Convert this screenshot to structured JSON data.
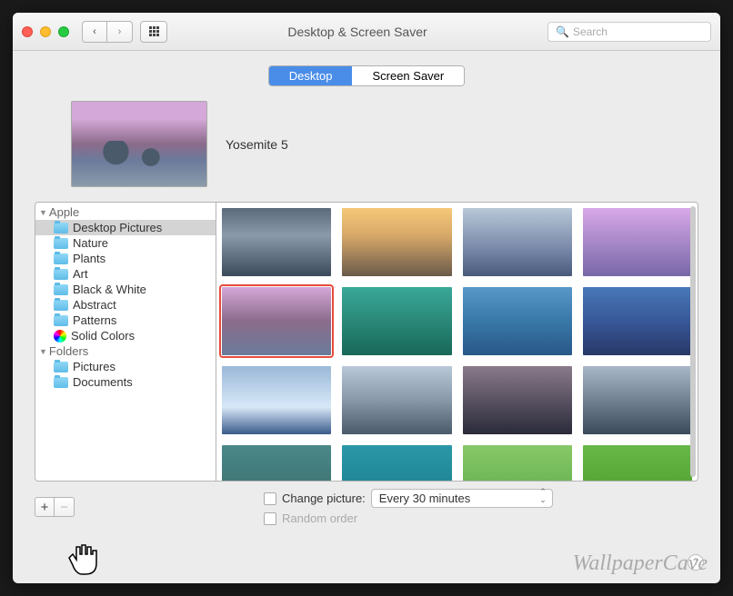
{
  "window": {
    "title": "Desktop & Screen Saver"
  },
  "search": {
    "placeholder": "Search"
  },
  "tabs": [
    {
      "label": "Desktop",
      "active": true
    },
    {
      "label": "Screen Saver",
      "active": false
    }
  ],
  "current_wallpaper": {
    "name": "Yosemite 5"
  },
  "sidebar": {
    "groups": [
      {
        "label": "Apple",
        "items": [
          {
            "label": "Desktop Pictures",
            "selected": true,
            "icon": "folder"
          },
          {
            "label": "Nature",
            "icon": "folder"
          },
          {
            "label": "Plants",
            "icon": "folder"
          },
          {
            "label": "Art",
            "icon": "folder"
          },
          {
            "label": "Black & White",
            "icon": "folder"
          },
          {
            "label": "Abstract",
            "icon": "folder"
          },
          {
            "label": "Patterns",
            "icon": "folder"
          },
          {
            "label": "Solid Colors",
            "icon": "colorwheel"
          }
        ]
      },
      {
        "label": "Folders",
        "items": [
          {
            "label": "Pictures",
            "icon": "folder"
          },
          {
            "label": "Documents",
            "icon": "folder"
          }
        ]
      }
    ]
  },
  "thumbnails": [
    {
      "bg": "linear-gradient(#5a6a7a, #8a9aaa 40%, #3a4a5a)"
    },
    {
      "bg": "linear-gradient(#f5c878, #d8a868 40%, #6a5a4a)"
    },
    {
      "bg": "linear-gradient(#b8c8d8, #7888a8 60%, #4a5a7a)"
    },
    {
      "bg": "linear-gradient(#d8a8e8, #a888c8 50%, #7868a8)"
    },
    {
      "bg": "linear-gradient(#d4a8d8, #8b6b8b 50%, #6b7b9b)",
      "selected": true
    },
    {
      "bg": "linear-gradient(#3aa898, #2a8878 50%, #186858)"
    },
    {
      "bg": "linear-gradient(#5898c8, #3878a8 50%, #285888)"
    },
    {
      "bg": "linear-gradient(#4878b8, #385898 50%, #283868)"
    },
    {
      "bg": "linear-gradient(#9ab8d8, #d8e8f8 60%, #3a5a8a)"
    },
    {
      "bg": "linear-gradient(#b8c8d8, #8898a8 50%, #4a5a6a)"
    },
    {
      "bg": "linear-gradient(#8a7a8a, #2a2a3a)"
    },
    {
      "bg": "linear-gradient(#a8b8c8, #3a4a5a)"
    },
    {
      "bg": "linear-gradient(#4a8888, #3a6868)"
    },
    {
      "bg": "linear-gradient(#2a98a8, #187888)"
    },
    {
      "bg": "linear-gradient(#88c868, #58a848)"
    },
    {
      "bg": "linear-gradient(#68b848, #489828)"
    },
    {
      "bg": "linear-gradient(#e8c888, #c8a868 50%, #8a7a5a)"
    },
    {
      "bg": "linear-gradient(#d8c8a8, #b8a888 50%, #6a5a4a)"
    },
    {
      "bg": "linear-gradient(#b8b8a8, #8a8a7a 50%, #5a5a4a)"
    },
    {
      "bg": "linear-gradient(#98a8b8, #6a7a8a 50%, #4a5a6a)"
    }
  ],
  "controls": {
    "change_picture_label": "Change picture:",
    "interval": "Every 30 minutes",
    "random_order_label": "Random order"
  },
  "watermark": "WallpaperCave"
}
